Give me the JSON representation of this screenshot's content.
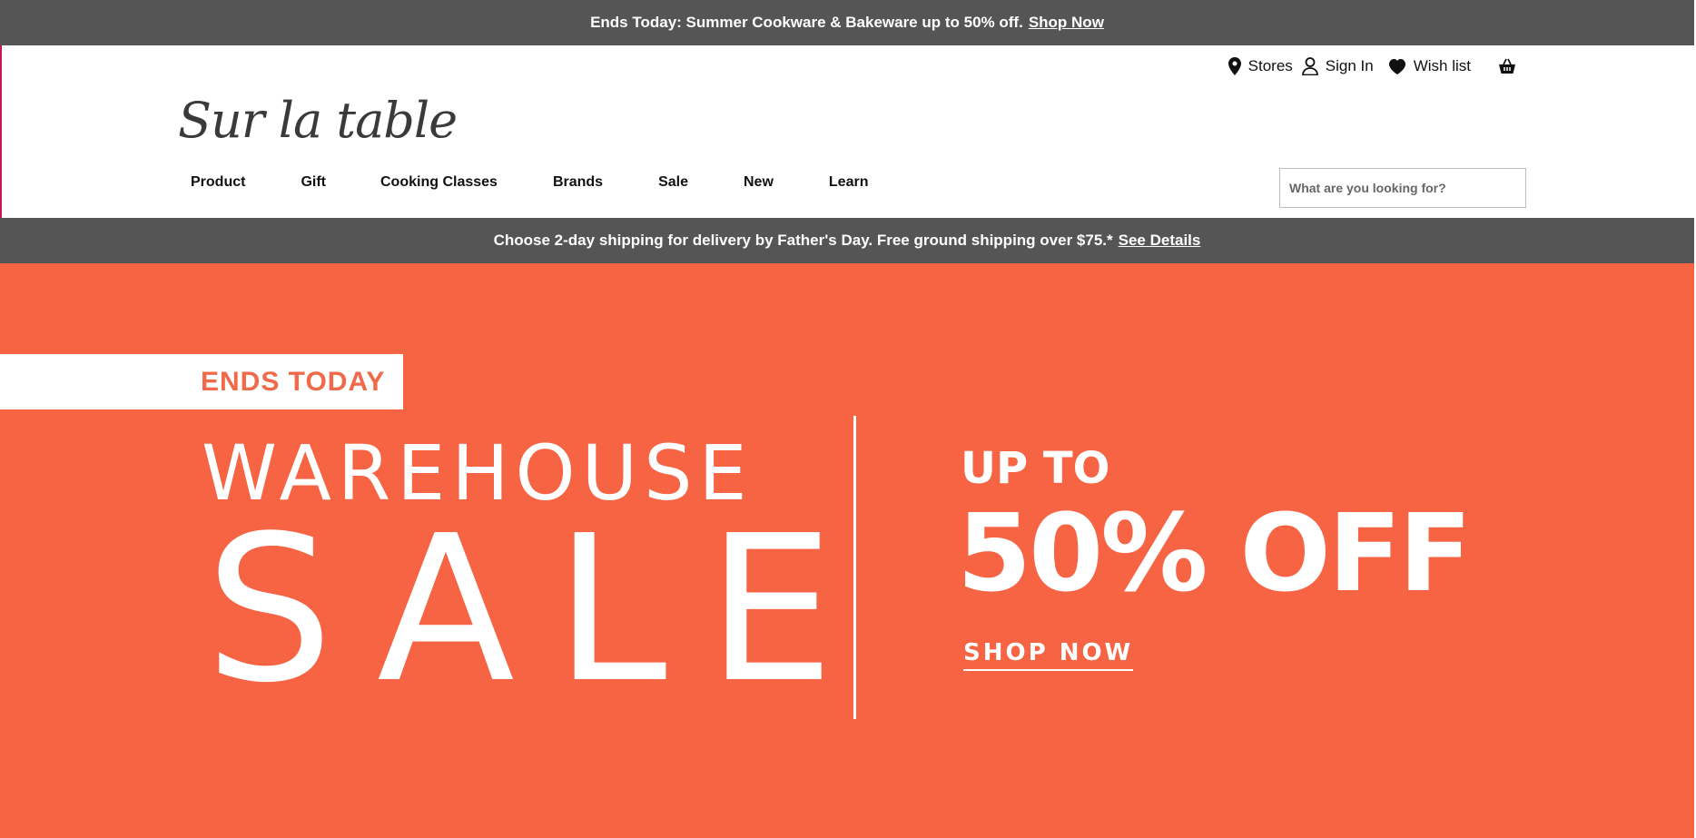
{
  "promo_top": {
    "text": "Ends Today: Summer Cookware & Bakeware up to 50% off.",
    "link": "Shop Now"
  },
  "utility_nav": {
    "stores": "Stores",
    "sign_in": "Sign In",
    "wish_list": "Wish list",
    "icons": [
      "location-pin-icon",
      "user-icon",
      "heart-icon",
      "basket-icon"
    ]
  },
  "logo": {
    "text": "Sur la table"
  },
  "main_nav": [
    "Product",
    "Gift",
    "Cooking Classes",
    "Brands",
    "Sale",
    "New",
    "Learn"
  ],
  "search": {
    "placeholder": "What are you looking for?",
    "value": ""
  },
  "promo_shipping": {
    "text": "Choose 2-day shipping for delivery by Father's Day. Free ground shipping over $75.*",
    "link": "See Details"
  },
  "hero": {
    "badge": "ENDS TODAY",
    "line1": "WAREHOUSE",
    "line2": "SALE",
    "offer_prefix": "UP TO",
    "offer": "50% OFF",
    "cta": "SHOP NOW"
  },
  "colors": {
    "banner_gray": "#555555",
    "hero_orange": "#f66444",
    "badge_text": "#f06a4a",
    "text_dark": "#111111"
  }
}
